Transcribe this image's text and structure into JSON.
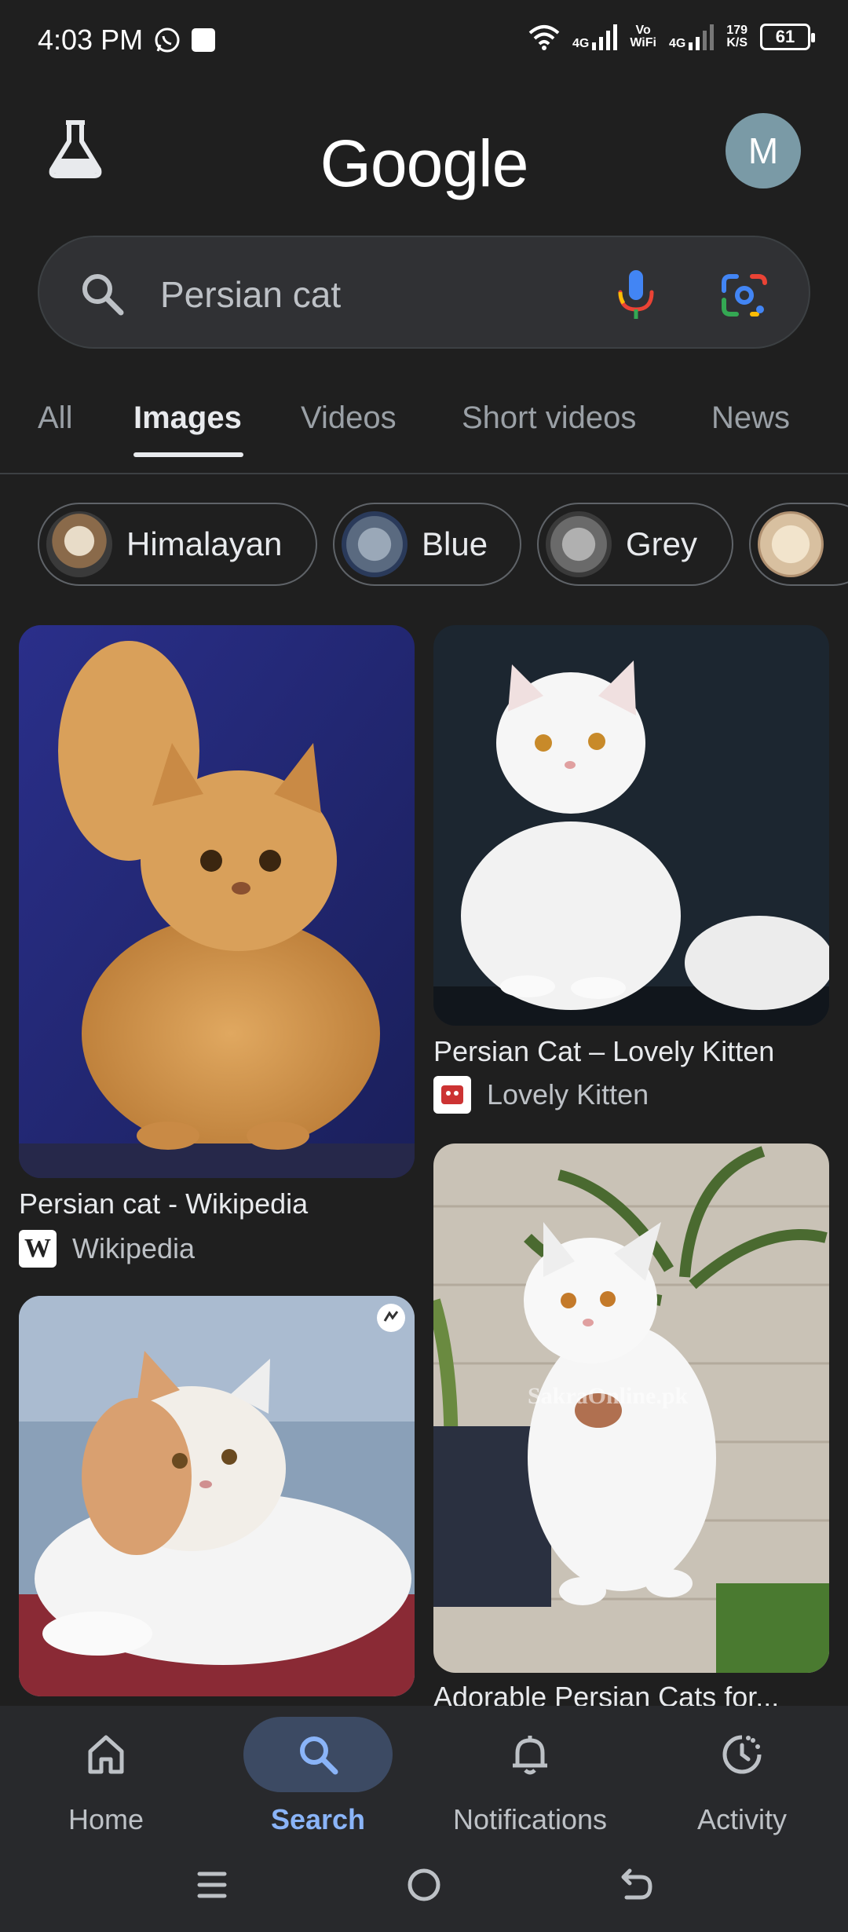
{
  "status": {
    "time": "4:03 PM",
    "net1": "4G",
    "vowifi_top": "Vo",
    "vowifi_bottom": "WiFi",
    "net2": "4G",
    "speed_top": "179",
    "speed_bottom": "K/S",
    "battery": "61"
  },
  "header": {
    "logo": "Google",
    "avatar_letter": "M"
  },
  "search": {
    "query": "Persian cat"
  },
  "tabs": [
    {
      "label": "All"
    },
    {
      "label": "Images"
    },
    {
      "label": "Videos"
    },
    {
      "label": "Short videos"
    },
    {
      "label": "News"
    }
  ],
  "chips": [
    {
      "label": "Himalayan"
    },
    {
      "label": "Blue"
    },
    {
      "label": "Grey"
    }
  ],
  "results": [
    {
      "title": "Persian cat - Wikipedia",
      "source": "Wikipedia",
      "favicon": "W"
    },
    {
      "title": "Persian Cat – Lovely Kitten",
      "source": "Lovely Kitten"
    },
    {
      "title": "Adorable Persian Cats for..."
    },
    {
      "watermark": "SakraOnline.pk"
    }
  ],
  "nav": [
    {
      "label": "Home",
      "icon": "home-icon"
    },
    {
      "label": "Search",
      "icon": "search-icon"
    },
    {
      "label": "Notifications",
      "icon": "bell-icon"
    },
    {
      "label": "Activity",
      "icon": "activity-icon"
    }
  ],
  "colors": {
    "background": "#1f1f1f",
    "search_box": "#303134",
    "active_nav": "#8ab4f8"
  }
}
